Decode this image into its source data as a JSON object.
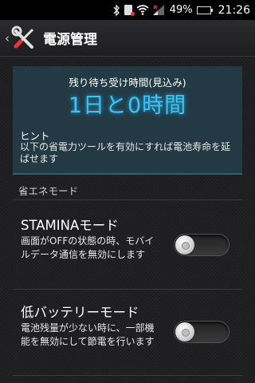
{
  "status_bar": {
    "battery_percent": "49%",
    "time": "21:26"
  },
  "action_bar": {
    "back": "‹",
    "title": "電源管理"
  },
  "info_panel": {
    "standby_label": "残り待ち受け時間(見込み)",
    "standby_value": "1日と0時間",
    "hint_title": "ヒント",
    "hint_text": "以下の省電力ツールを有効にすれば電池寿命を延ばせます"
  },
  "section": {
    "title": "省エネモード"
  },
  "settings": [
    {
      "title": "STAMINAモード",
      "description": "画面がOFFの状態の時、モバイルデータ通信を無効にします",
      "enabled": false
    },
    {
      "title": "低バッテリーモード",
      "description": "電池残量が少ない時に、一部機能を無効にして節電を行います",
      "enabled": false
    }
  ]
}
